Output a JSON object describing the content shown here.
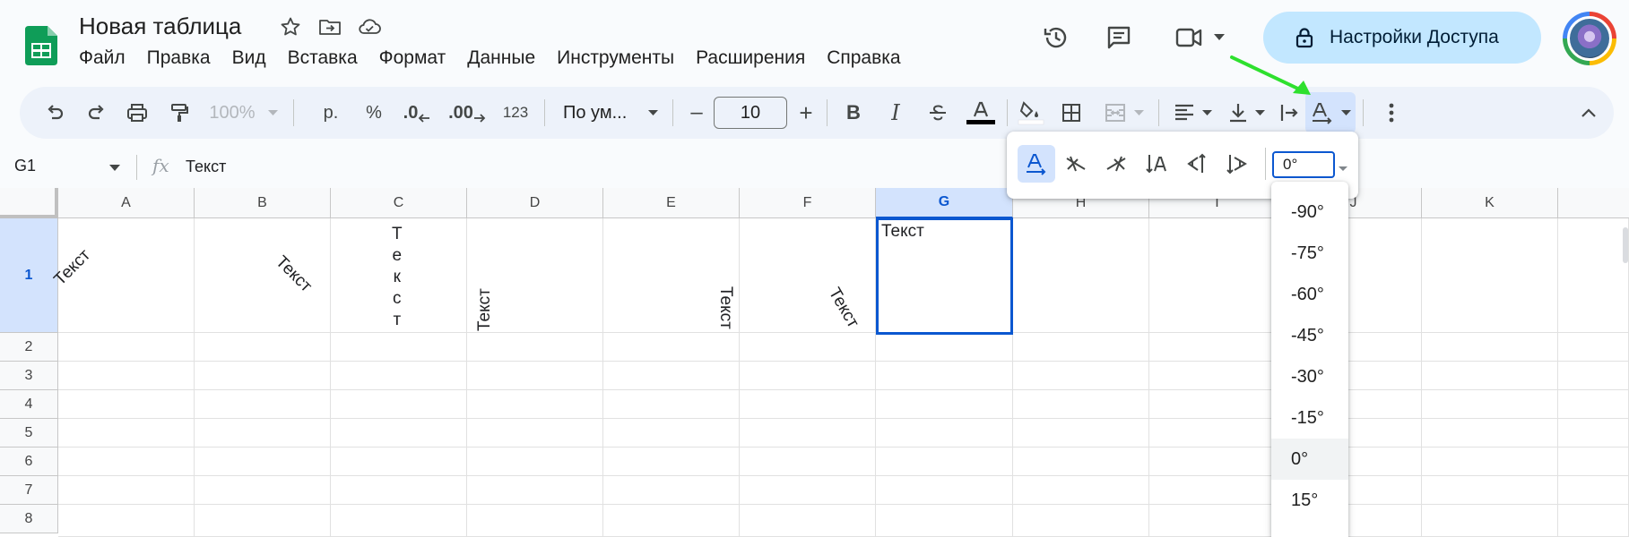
{
  "document": {
    "title": "Новая таблица"
  },
  "menu": [
    "Файл",
    "Правка",
    "Вид",
    "Вставка",
    "Формат",
    "Данные",
    "Инструменты",
    "Расширения",
    "Справка"
  ],
  "share": {
    "label": "Настройки Доступа"
  },
  "toolbar": {
    "zoom": "100%",
    "currency": "р.",
    "percent": "%",
    "decrease_decimals": ".0",
    "increase_decimals": ".00",
    "number_format": "123",
    "font": "По ум...",
    "font_size": "10",
    "minus": "–",
    "plus": "+",
    "bold": "B",
    "italic": "I"
  },
  "formula_bar": {
    "cell_ref": "G1",
    "fx": "fx",
    "content": "Текст"
  },
  "columns": [
    "A",
    "B",
    "C",
    "D",
    "E",
    "F",
    "G",
    "H",
    "I",
    "J",
    "K"
  ],
  "rows": [
    "1",
    "2",
    "3",
    "4",
    "5",
    "6",
    "7",
    "8"
  ],
  "selected": {
    "column": "G",
    "row": "1"
  },
  "cells": {
    "A1": "Текст",
    "B1": "Текст",
    "C1": [
      "Т",
      "е",
      "к",
      "с",
      "т"
    ],
    "D1": "Текст",
    "E1": "Текст",
    "F1": "Текст",
    "G1": "Текст"
  },
  "rotation_menu": {
    "angle_value": "0°",
    "options": [
      "-90°",
      "-75°",
      "-60°",
      "-45°",
      "-30°",
      "-15°",
      "0°",
      "15°"
    ],
    "selected_option": "0°"
  },
  "colors": {
    "accent": "#0b57d0",
    "share_bg": "#c2e7ff",
    "toolbar_bg": "#edf2fa",
    "sheets_green": "#0f9d58",
    "annotation_arrow": "#2ee02e"
  }
}
